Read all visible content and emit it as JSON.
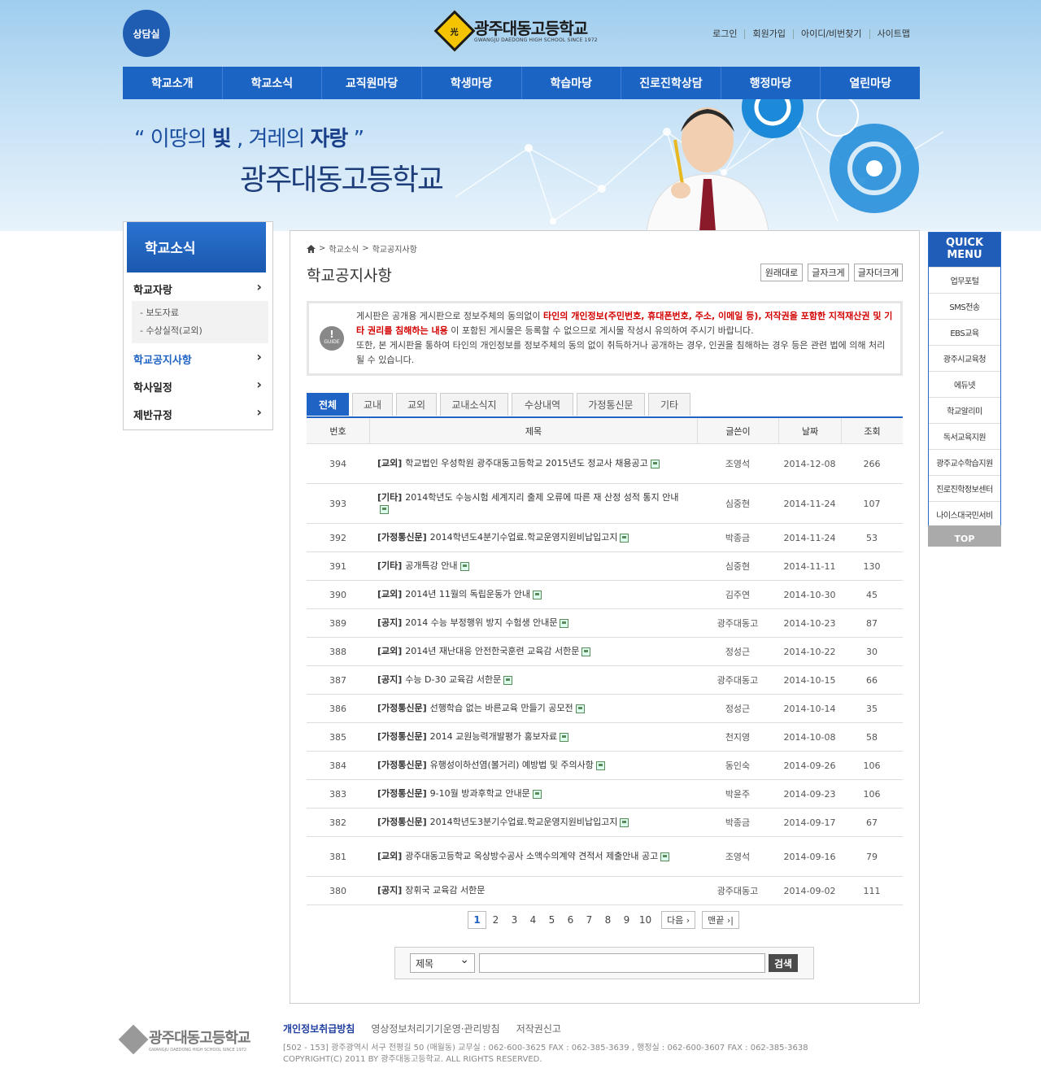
{
  "header": {
    "counsel_label": "상담실",
    "logo_emblem": "光",
    "logo_title": "광주대동고등학교",
    "logo_sub": "GWANGJU DAEDONG HIGH SCHOOL SINCE 1972",
    "util": [
      "로그인",
      "회원가입",
      "아이디/비번찾기",
      "사이트맵"
    ]
  },
  "gnb": [
    "학교소개",
    "학교소식",
    "교직원마당",
    "학생마당",
    "학습마당",
    "진로진학상담",
    "행정마당",
    "열린마당"
  ],
  "visual": {
    "slogan_quote_open": "“ 이땅의 ",
    "slogan_b1": "빛",
    "slogan_mid": " , 겨레의 ",
    "slogan_b2": "자랑",
    "slogan_quote_close": " ”",
    "slogan2": "광주대동고등학교"
  },
  "lnb": {
    "title": "학교소식",
    "items": [
      {
        "label": "학교자랑"
      },
      {
        "label": "학교공지사항"
      },
      {
        "label": "학사일정"
      },
      {
        "label": "제반규정"
      }
    ],
    "sub": [
      "- 보도자료",
      "- 수상실적(교외)"
    ]
  },
  "content": {
    "breadcrumb": [
      "학교소식",
      "학교공지사항"
    ],
    "title": "학교공지사항",
    "font_buttons": [
      "원래대로",
      "글자크게",
      "글자더크게"
    ],
    "guide_label": "GUIDE",
    "guide_p1": "게시판은 공개용 게시판으로 정보주체의 동의없이 ",
    "guide_b1": "타인의 개인정보(주민번호, 휴대폰번호, 주소, 이메일 등), 저작권을 포함한 지적재산권 및 기타 권리를 침해하는 내용",
    "guide_p2": "이 포함된 게시물은 등록할 수 없으므로 게시물 작성시 유의하여 주시기 바랍니다.",
    "guide_p3": "또한, 본 게시판을 통하여 타인의 개인정보를 정보주체의 동의 없이 취득하거나 공개하는 경우, 인권을 침해하는 경우 등은 관련 법에 의해 처리될 수 있습니다.",
    "tabs": [
      "전체",
      "교내",
      "교외",
      "교내소식지",
      "수상내역",
      "가정통신문",
      "기타"
    ],
    "columns": [
      "번호",
      "제목",
      "글쓴이",
      "날짜",
      "조회"
    ],
    "rows": [
      {
        "no": "394",
        "cat": "[교외]",
        "title": "학교법인 우성학원 광주대동고등학교 2015년도 정교사 채용공고",
        "writer": "조영석",
        "date": "2014-12-08",
        "views": "266",
        "h": 49
      },
      {
        "no": "393",
        "cat": "[기타]",
        "title": "2014학년도 수능시험 세계지리 출제 오류에 따른 재 산정 성적 통지 안내",
        "writer": "심중현",
        "date": "2014-11-24",
        "views": "107",
        "h": 49
      },
      {
        "no": "392",
        "cat": "[가정통신문]",
        "title": "2014학년도4분기수업료.학교운영지원비납입고지",
        "writer": "박종금",
        "date": "2014-11-24",
        "views": "53",
        "h": 35
      },
      {
        "no": "391",
        "cat": "[기타]",
        "title": "공개특강 안내",
        "writer": "심중현",
        "date": "2014-11-11",
        "views": "130",
        "h": 35
      },
      {
        "no": "390",
        "cat": "[교외]",
        "title": "2014년 11월의 독립운동가 안내",
        "writer": "김주연",
        "date": "2014-10-30",
        "views": "45",
        "h": 35
      },
      {
        "no": "389",
        "cat": "[공지]",
        "title": "2014 수능 부정행위 방지 수험생 안내문",
        "writer": "광주대동고",
        "date": "2014-10-23",
        "views": "87",
        "h": 35
      },
      {
        "no": "388",
        "cat": "[교외]",
        "title": "2014년 재난대응 안전한국훈련 교육감 서한문",
        "writer": "정성근",
        "date": "2014-10-22",
        "views": "30",
        "h": 35
      },
      {
        "no": "387",
        "cat": "[공지]",
        "title": "수능 D-30 교육감 서한문",
        "writer": "광주대동고",
        "date": "2014-10-15",
        "views": "66",
        "h": 35
      },
      {
        "no": "386",
        "cat": "[가정통신문]",
        "title": "선행학습 없는 바른교육 만들기 공모전",
        "writer": "정성근",
        "date": "2014-10-14",
        "views": "35",
        "h": 35
      },
      {
        "no": "385",
        "cat": "[가정통신문]",
        "title": "2014 교원능력개발평가 홍보자료",
        "writer": "천지영",
        "date": "2014-10-08",
        "views": "58",
        "h": 35
      },
      {
        "no": "384",
        "cat": "[가정통신문]",
        "title": "유행성이하선염(볼거리) 예방법 및 주의사항",
        "writer": "동인숙",
        "date": "2014-09-26",
        "views": "106",
        "h": 35
      },
      {
        "no": "383",
        "cat": "[가정통신문]",
        "title": "9-10월 방과후학교 안내문",
        "writer": "박윤주",
        "date": "2014-09-23",
        "views": "106",
        "h": 35
      },
      {
        "no": "382",
        "cat": "[가정통신문]",
        "title": "2014학년도3분기수업료.학교운영지원비납입고지",
        "writer": "박종금",
        "date": "2014-09-17",
        "views": "67",
        "h": 35
      },
      {
        "no": "381",
        "cat": "[교외]",
        "title": "광주대동고등학교 옥상방수공사 소액수의계약 견적서 제출안내 공고",
        "writer": "조영석",
        "date": "2014-09-16",
        "views": "79",
        "h": 49
      },
      {
        "no": "380",
        "cat": "[공지]",
        "title": "장휘국 교육감 서한문",
        "writer": "광주대동고",
        "date": "2014-09-02",
        "views": "111",
        "h": 35,
        "nofile": true
      }
    ],
    "pages": [
      "1",
      "2",
      "3",
      "4",
      "5",
      "6",
      "7",
      "8",
      "9",
      "10"
    ],
    "next_label": "다음 ›",
    "last_label": "맨끝 ›|",
    "search_select": "제목",
    "search_btn": "검색"
  },
  "quick": {
    "title1": "QUICK",
    "title2": "MENU",
    "items": [
      "업무포털",
      "SMS전송",
      "EBS교육",
      "광주시교육청",
      "에듀넷",
      "학교알리미",
      "독서교육지원",
      "광주교수학습지원",
      "진로진학정보센터",
      "나이스대국민서비"
    ],
    "top": "TOP"
  },
  "footer": {
    "logo_title": "광주대동고등학교",
    "logo_sub": "GWANGJU DAEDONG HIGH SCHOOL SINCE 1972",
    "links": [
      "개인정보취급방침",
      "영상정보처리기기운영·관리방침",
      "저작권신고"
    ],
    "addr": "[502 - 153] 광주광역시 서구 전평길 50 (매월동)    교무실 : 062-600-3625   FAX : 062-385-3639 ,    행정실 : 062-600-3607   FAX : 062-385-3638",
    "copy": "COPYRIGHT(C) 2011 BY 광주대동고등학교. ALL RIGHTS RESERVED."
  },
  "colors": {
    "primary": "#1f64c4",
    "alert": "#d30000"
  }
}
